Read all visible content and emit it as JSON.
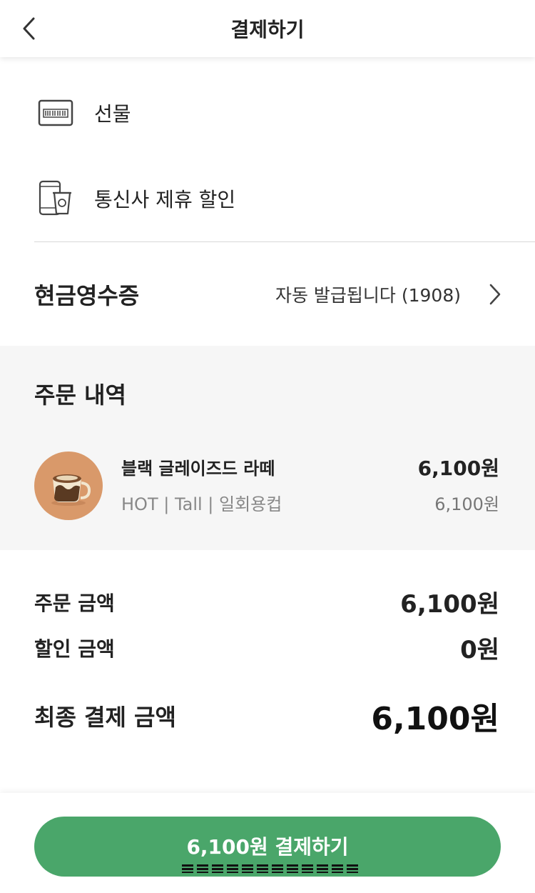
{
  "header": {
    "title": "결제하기",
    "back_icon": "chevron-left-icon"
  },
  "options": [
    {
      "label": "선물",
      "icon": "gift-card-icon"
    },
    {
      "label": "통신사 제휴 할인",
      "icon": "phone-cup-icon"
    }
  ],
  "receipt": {
    "title": "현금영수증",
    "value": "자동 발급됩니다 (1908)"
  },
  "order": {
    "title": "주문 내역",
    "item": {
      "name": "블랙 글레이즈드 라떼",
      "options": "HOT | Tall | 일회용컵",
      "price": "6,100원",
      "unit_price": "6,100원"
    }
  },
  "summary": {
    "order_amount_label": "주문 금액",
    "order_amount": "6,100원",
    "discount_label": "할인 금액",
    "discount": "0원",
    "final_label": "최종 결제 금액",
    "final_amount": "6,100원"
  },
  "pay_button": {
    "label": "6,100원 결제하기"
  },
  "colors": {
    "accent": "#4aa66a",
    "section_bg": "#f6f6f6",
    "thumb_bg": "#d9996a"
  }
}
